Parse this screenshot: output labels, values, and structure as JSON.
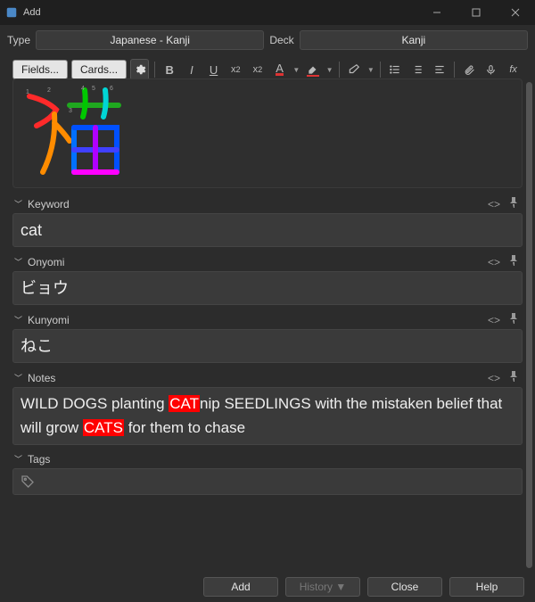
{
  "window": {
    "title": "Add"
  },
  "type_row": {
    "type_label": "Type",
    "type_value": "Japanese - Kanji",
    "deck_label": "Deck",
    "deck_value": "Kanji"
  },
  "toolbar": {
    "fields": "Fields...",
    "cards": "Cards..."
  },
  "fields": {
    "keyword": {
      "label": "Keyword",
      "value": "cat"
    },
    "onyomi": {
      "label": "Onyomi",
      "value": "ビョウ"
    },
    "kunyomi": {
      "label": "Kunyomi",
      "value": "ねこ"
    },
    "notes": {
      "label": "Notes",
      "pre1": "WILD DOGS planting ",
      "h1": "CAT",
      "mid1": "nip SEEDLINGS with the mistaken belief that will grow ",
      "h2": "CATS",
      "post": " for them to chase"
    },
    "tags": {
      "label": "Tags"
    }
  },
  "footer": {
    "add": "Add",
    "history": "History ▼",
    "close": "Close",
    "help": "Help"
  }
}
